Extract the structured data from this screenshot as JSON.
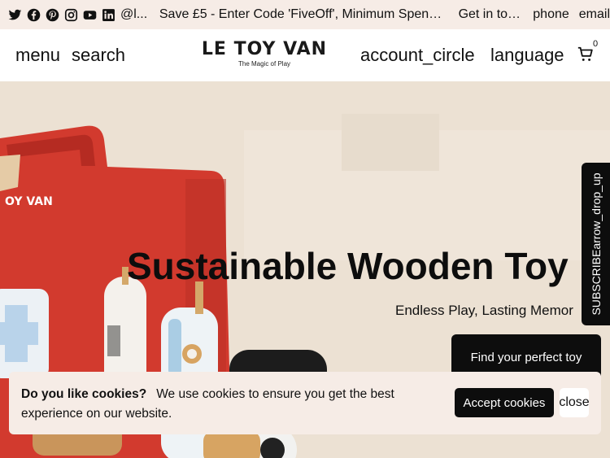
{
  "topbar": {
    "socials": [
      {
        "name": "twitter-icon"
      },
      {
        "name": "facebook-icon"
      },
      {
        "name": "pinterest-icon"
      },
      {
        "name": "instagram-icon"
      },
      {
        "name": "youtube-icon"
      },
      {
        "name": "linkedin-icon"
      }
    ],
    "handle": "@l...",
    "promo": "Save £5 - Enter Code 'FiveOff', Minimum Spend £1...",
    "touch": "Get in tou...",
    "phone": "phone",
    "email": "email"
  },
  "header": {
    "menu": "menu",
    "search": "search",
    "logo_main": "LE TOY VAN",
    "logo_sub": "The Magic of Play",
    "account": "account_circle",
    "language": "language",
    "cart_count": "0"
  },
  "hero": {
    "title": "Sustainable Wooden Toy",
    "subtitle": "Endless Play, Lasting Memor",
    "button": "Find your perfect toy",
    "box_brand": "OY VAN"
  },
  "subscribe": {
    "label": "SUBSCRIBEarrow_drop_up"
  },
  "cookie": {
    "heading": "Do you like cookies?",
    "message": "We use cookies to ensure you get the best experience on our website.",
    "accept": "Accept cookies",
    "close": "close"
  },
  "colors": {
    "topbar_bg": "#f6ece6",
    "hero_bg": "#ece1d3",
    "button_bg": "#0d0d0d",
    "toy_red": "#d23a2e"
  }
}
